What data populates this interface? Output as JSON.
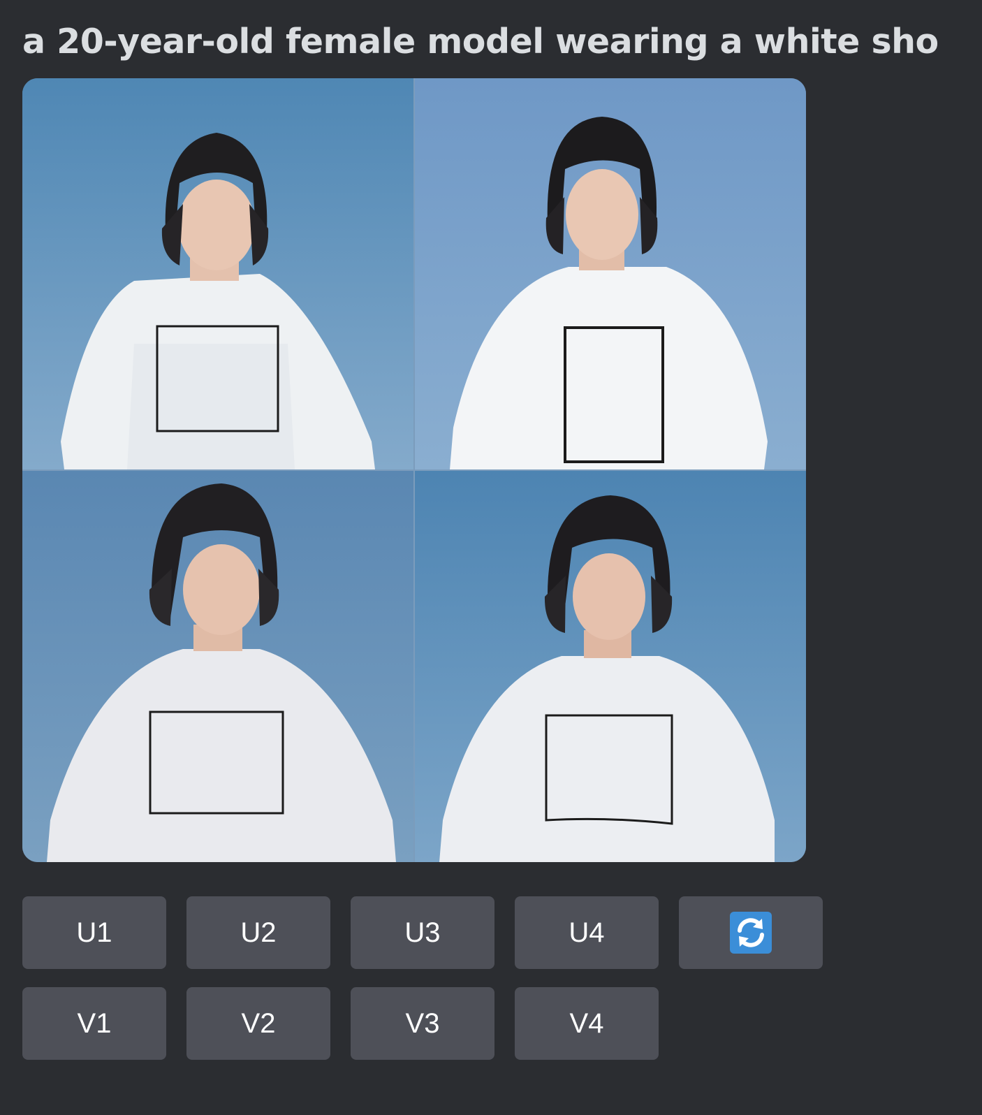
{
  "message": {
    "previous_line_fragment": "",
    "prompt_text": "a 20-year-old female model wearing a white sho"
  },
  "image_grid": {
    "description_alt": "",
    "tiles": [
      {
        "label": ""
      },
      {
        "label": ""
      },
      {
        "label": ""
      },
      {
        "label": ""
      }
    ]
  },
  "actions": {
    "upscale": [
      "U1",
      "U2",
      "U3",
      "U4"
    ],
    "variation": [
      "V1",
      "V2",
      "V3",
      "V4"
    ],
    "reroll_icon": "refresh-icon"
  },
  "colors": {
    "background": "#2b2d31",
    "button": "#4e5058",
    "button_text": "#ffffff",
    "text": "#dbdee1",
    "refresh_icon_bg": "#3b8ed8"
  }
}
